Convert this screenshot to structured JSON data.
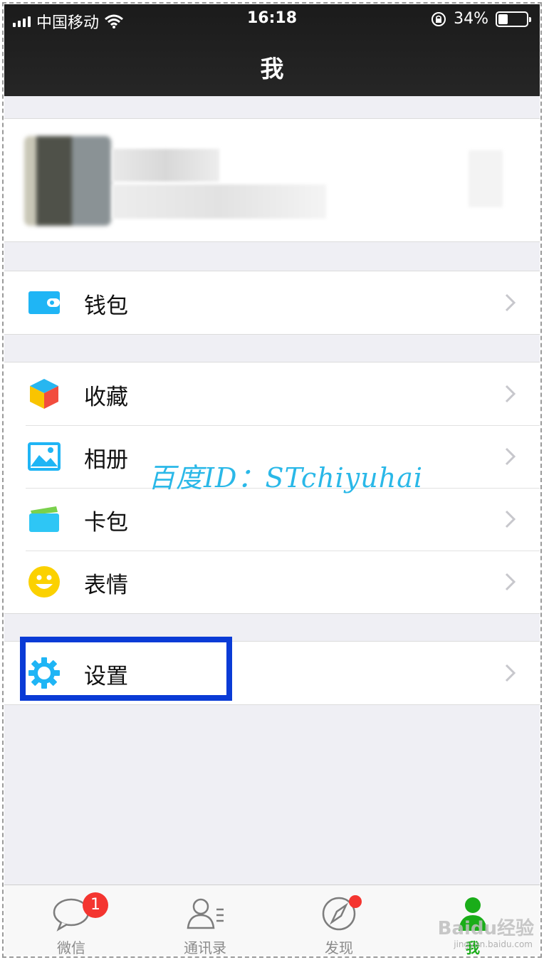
{
  "status_bar": {
    "carrier": "中国移动",
    "time": "16:18",
    "battery_percent": "34%",
    "battery_level": 0.34
  },
  "nav": {
    "title": "我"
  },
  "menu": {
    "wallet": "钱包",
    "favorites": "收藏",
    "album": "相册",
    "cards": "卡包",
    "stickers": "表情",
    "settings": "设置"
  },
  "watermark": "百度ID：STchiyuhai",
  "tabbar": {
    "tabs": [
      {
        "label": "微信",
        "badge": "1"
      },
      {
        "label": "通讯录"
      },
      {
        "label": "发现"
      },
      {
        "label": "我"
      }
    ],
    "baidu_watermark": "Baidu经验",
    "baidu_watermark_sub": "jingyan.baidu.com"
  },
  "colors": {
    "active_tab": "#1aad19",
    "highlight_box": "#0a3bd6",
    "badge": "#f43530",
    "icon_blue": "#1fb5f5"
  }
}
